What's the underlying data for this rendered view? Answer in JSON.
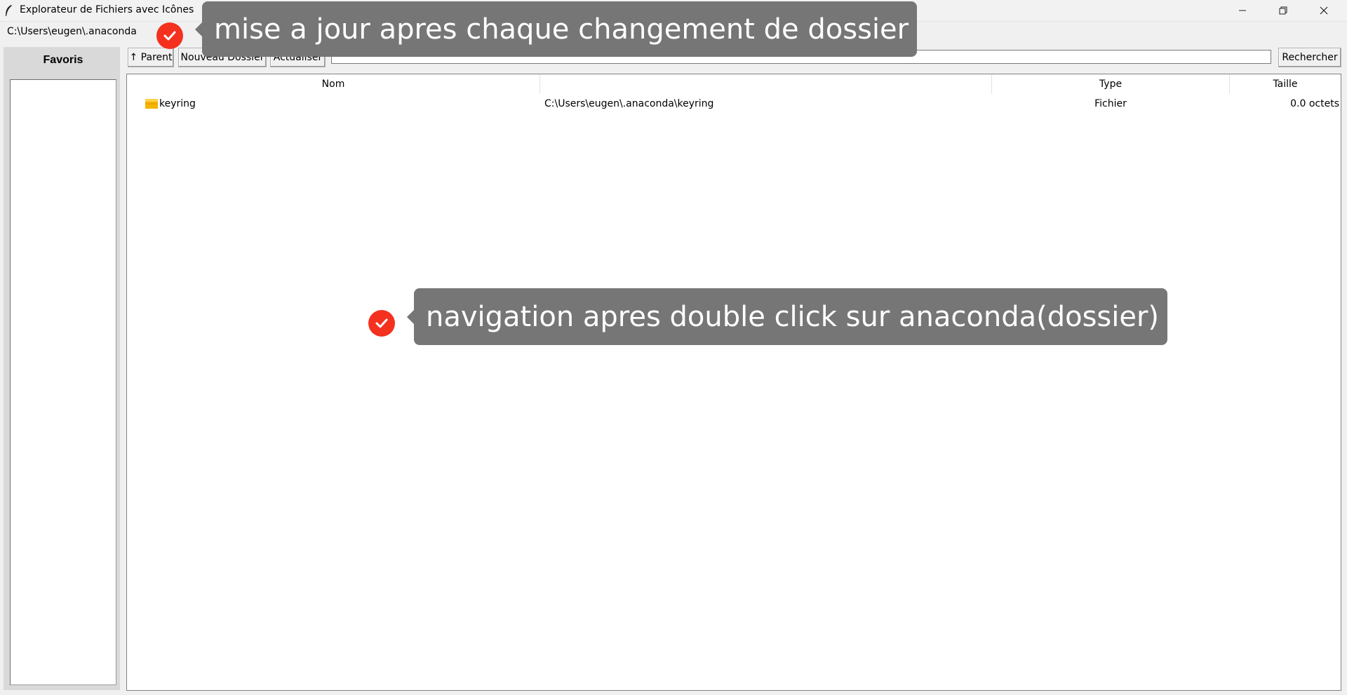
{
  "window": {
    "title": "Explorateur de Fichiers avec Icônes",
    "minimize_icon": "minimize-icon",
    "maximize_icon": "restore-icon",
    "close_icon": "close-icon"
  },
  "current_path": "C:\\Users\\eugen\\.anaconda",
  "favorites": {
    "title": "Favoris",
    "items": []
  },
  "toolbar": {
    "parent_label": "↑ Parent",
    "new_folder_label": "Nouveau Dossier",
    "refresh_label": "Actualiser",
    "search_value": "",
    "search_label": "Rechercher"
  },
  "table": {
    "columns": [
      "Nom",
      "",
      "Type",
      "Taille"
    ],
    "rows": [
      {
        "icon": "folder-icon",
        "name": "keyring",
        "path": "C:\\Users\\eugen\\.anaconda\\keyring",
        "type": "Fichier",
        "size": "0.0 octets"
      }
    ]
  },
  "annotations": [
    {
      "text": "mise a jour apres chaque changement de dossier",
      "icon": "check-icon"
    },
    {
      "text": "navigation apres double click sur anaconda(dossier)",
      "icon": "check-icon"
    }
  ],
  "colors": {
    "badge": "#f4311f",
    "callout": "#767676",
    "folder": "#f5b400"
  }
}
